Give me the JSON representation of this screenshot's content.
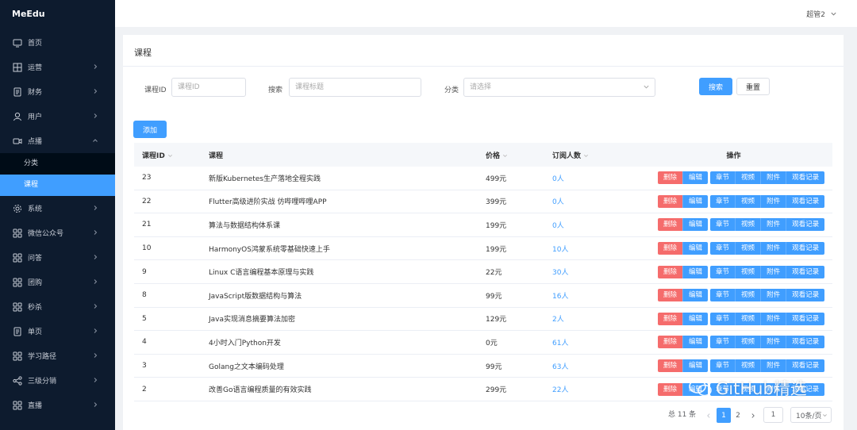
{
  "app": {
    "logo": "MeEdu"
  },
  "header": {
    "user_name": "超管2"
  },
  "sidebar": {
    "items": [
      {
        "label": "首页",
        "icon": "monitor-icon",
        "arrow": false
      },
      {
        "label": "运营",
        "icon": "grid-icon",
        "arrow": true
      },
      {
        "label": "财务",
        "icon": "document-icon",
        "arrow": true
      },
      {
        "label": "用户",
        "icon": "user-icon",
        "arrow": true
      },
      {
        "label": "点播",
        "icon": "video-icon",
        "arrow": true,
        "expanded": true
      },
      {
        "label": "系统",
        "icon": "gear-icon",
        "arrow": true
      },
      {
        "label": "微信公众号",
        "icon": "apps-icon",
        "arrow": true
      },
      {
        "label": "问答",
        "icon": "apps-icon",
        "arrow": true
      },
      {
        "label": "团购",
        "icon": "apps-icon",
        "arrow": true
      },
      {
        "label": "秒杀",
        "icon": "apps-icon",
        "arrow": true
      },
      {
        "label": "单页",
        "icon": "document-icon",
        "arrow": true
      },
      {
        "label": "学习路径",
        "icon": "apps-icon",
        "arrow": true
      },
      {
        "label": "三级分销",
        "icon": "share-icon",
        "arrow": true
      },
      {
        "label": "直播",
        "icon": "apps-icon",
        "arrow": true
      }
    ],
    "sub_items": [
      {
        "label": "分类",
        "active": false
      },
      {
        "label": "课程",
        "active": true
      }
    ]
  },
  "page": {
    "title": "课程",
    "filters": {
      "course_id_label": "课程ID",
      "course_id_placeholder": "课程ID",
      "search_label": "搜索",
      "search_placeholder": "课程标题",
      "category_label": "分类",
      "category_placeholder": "请选择"
    },
    "buttons": {
      "search": "搜索",
      "reset": "重置",
      "add": "添加"
    }
  },
  "table": {
    "headers": {
      "id": "课程ID",
      "name": "课程",
      "price": "价格",
      "subscribers": "订阅人数",
      "operations": "操作"
    },
    "actions": [
      "删除",
      "编辑",
      "章节",
      "视频",
      "附件",
      "观看记录"
    ],
    "rows": [
      {
        "id": "23",
        "name": "新版Kubernetes生产落地全程实践",
        "price": "499元",
        "subscribers": "0人"
      },
      {
        "id": "22",
        "name": "Flutter高级进阶实战 仿哔哩哔哩APP",
        "price": "399元",
        "subscribers": "0人"
      },
      {
        "id": "21",
        "name": "算法与数据结构体系课",
        "price": "199元",
        "subscribers": "0人"
      },
      {
        "id": "10",
        "name": "HarmonyOS鸿蒙系统零基础快速上手",
        "price": "199元",
        "subscribers": "10人"
      },
      {
        "id": "9",
        "name": "Linux C语言编程基本原理与实践",
        "price": "22元",
        "subscribers": "30人"
      },
      {
        "id": "8",
        "name": "JavaScript版数据结构与算法",
        "price": "99元",
        "subscribers": "16人"
      },
      {
        "id": "5",
        "name": "Java实现消息摘要算法加密",
        "price": "129元",
        "subscribers": "2人"
      },
      {
        "id": "4",
        "name": "4小时入门Python开发",
        "price": "0元",
        "subscribers": "61人"
      },
      {
        "id": "3",
        "name": "Golang之文本编码处理",
        "price": "99元",
        "subscribers": "63人"
      },
      {
        "id": "2",
        "name": "改善Go语言编程质量的有效实践",
        "price": "299元",
        "subscribers": "22人"
      }
    ]
  },
  "pagination": {
    "total": "总 11 条",
    "pages": [
      "1",
      "2"
    ],
    "current": "1",
    "jumper": "1",
    "page_size": "10条/页"
  },
  "watermark": {
    "text": "GitHub精选"
  },
  "colors": {
    "sidebar_bg": "#0d1b2e",
    "primary": "#409eff",
    "danger": "#f56c6c"
  }
}
